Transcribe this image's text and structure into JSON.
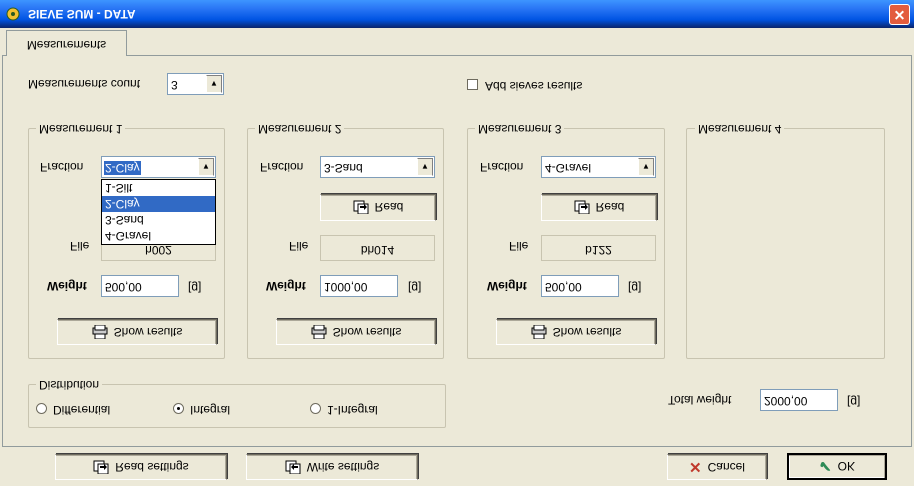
{
  "window": {
    "title": "SIEVE SUM - DATA"
  },
  "tabs": {
    "active": "Measurements"
  },
  "measurements_count": {
    "label": "Measurements count",
    "value": "3"
  },
  "add_sieves": {
    "label": "Add sieves results",
    "checked": false
  },
  "measurements": [
    {
      "title": "Measurement 1",
      "show_label": "Show results",
      "weight_label": "Weight",
      "weight": "500,00",
      "unit": "[g]",
      "file_label": "File",
      "file": "h002",
      "fraction_label": "Fraction",
      "fraction": "2-Clay",
      "dropdown_options": [
        "4-Gravel",
        "3-Sand",
        "2-Clay",
        "1-Silt"
      ],
      "dropdown_selected": "2-Clay"
    },
    {
      "title": "Measurement 2",
      "show_label": "Show results",
      "weight_label": "Weight",
      "weight": "1000,00",
      "unit": "[g]",
      "file_label": "File",
      "file": "bh014",
      "read_label": "Read",
      "fraction_label": "Fraction",
      "fraction": "3-Sand"
    },
    {
      "title": "Measurement 3",
      "show_label": "Show results",
      "weight_label": "Weight",
      "weight": "500,00",
      "unit": "[g]",
      "file_label": "File",
      "file": "b122",
      "read_label": "Read",
      "fraction_label": "Fraction",
      "fraction": "4-Gravel"
    },
    {
      "title": "Measurement 4"
    }
  ],
  "distribution": {
    "title": "Distribution",
    "options": [
      "Differential",
      "Integral",
      "1-Integral"
    ],
    "selected": "Integral"
  },
  "total_weight": {
    "label": "Total weight",
    "value": "2000,00",
    "unit": "[g]"
  },
  "toolbar": {
    "read_settings": "Read settings",
    "write_settings": "Write settings",
    "cancel": "Cancel",
    "ok": "OK"
  },
  "colors": {
    "titlebar": "#0058ee",
    "selection": "#316ac5",
    "close": "#e35c3e",
    "cancel_icon": "#c0392b",
    "ok_icon": "#2e8b57"
  }
}
